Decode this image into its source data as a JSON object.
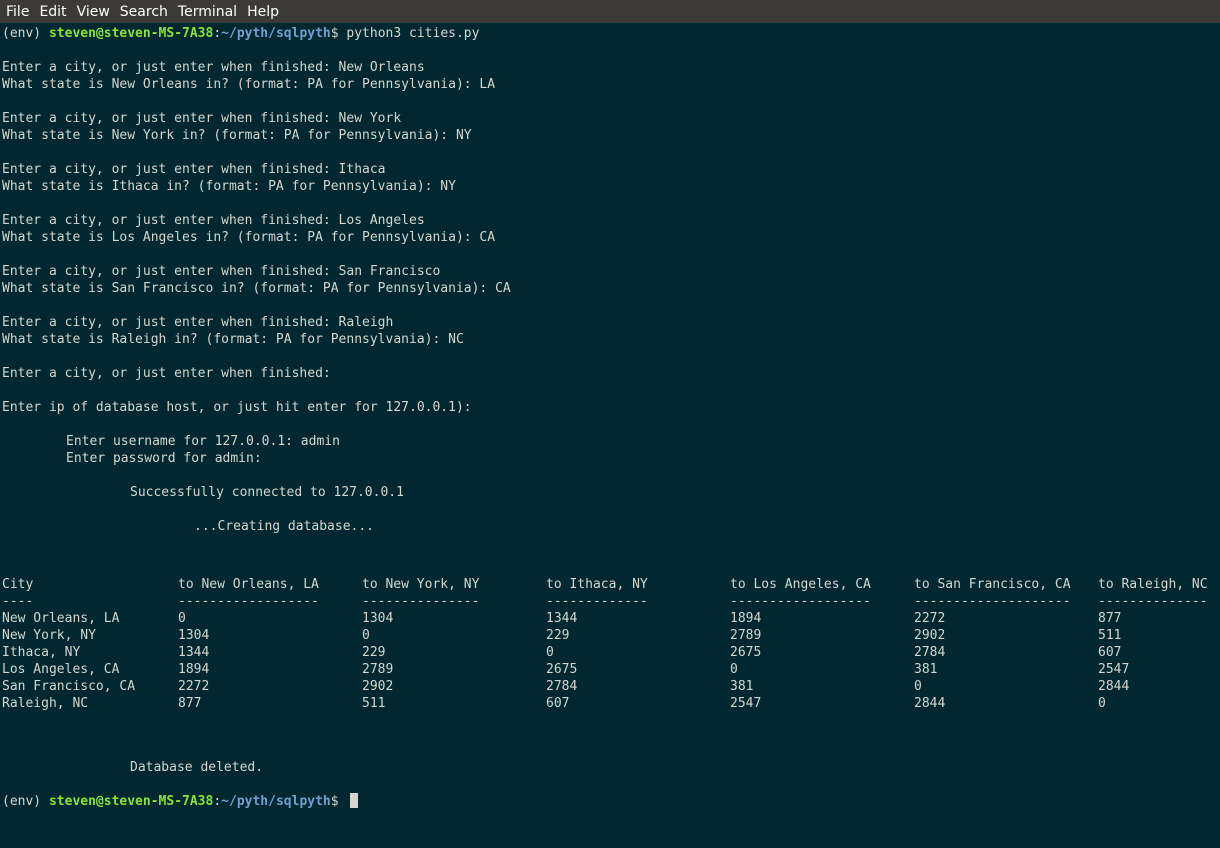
{
  "menu": [
    "File",
    "Edit",
    "View",
    "Search",
    "Terminal",
    "Help"
  ],
  "prompt": {
    "env": "(env) ",
    "user_host": "steven@steven-MS-7A38",
    "colon": ":",
    "path": "~/pyth/sqlpyth",
    "dollar": "$ ",
    "command": "python3 cities.py"
  },
  "session": [
    "",
    "Enter a city, or just enter when finished: New Orleans",
    "What state is New Orleans in? (format: PA for Pennsylvania): LA",
    "",
    "Enter a city, or just enter when finished: New York",
    "What state is New York in? (format: PA for Pennsylvania): NY",
    "",
    "Enter a city, or just enter when finished: Ithaca",
    "What state is Ithaca in? (format: PA for Pennsylvania): NY",
    "",
    "Enter a city, or just enter when finished: Los Angeles",
    "What state is Los Angeles in? (format: PA for Pennsylvania): CA",
    "",
    "Enter a city, or just enter when finished: San Francisco",
    "What state is San Francisco in? (format: PA for Pennsylvania): CA",
    "",
    "Enter a city, or just enter when finished: Raleigh",
    "What state is Raleigh in? (format: PA for Pennsylvania): NC",
    "",
    "Enter a city, or just enter when finished:",
    "",
    "Enter ip of database host, or just hit enter for 127.0.0.1):",
    ""
  ],
  "login": {
    "username_line": "Enter username for 127.0.0.1: admin",
    "password_line": "Enter password for admin:",
    "connected": "Successfully connected to 127.0.0.1",
    "creating": "...Creating database..."
  },
  "table": {
    "headers": [
      "City",
      "to New Orleans, LA",
      "to New York, NY",
      "to Ithaca, NY",
      "to Los Angeles, CA",
      "to San Francisco, CA",
      "to Raleigh, NC"
    ],
    "separators": [
      "----",
      "------------------",
      "---------------",
      "-------------",
      "------------------",
      "--------------------",
      "--------------"
    ],
    "rows": [
      [
        "New Orleans, LA",
        "0",
        "1304",
        "1344",
        "1894",
        "2272",
        "877"
      ],
      [
        "New York, NY",
        "1304",
        "0",
        "229",
        "2789",
        "2902",
        "511"
      ],
      [
        "Ithaca, NY",
        "1344",
        "229",
        "0",
        "2675",
        "2784",
        "607"
      ],
      [
        "Los Angeles, CA",
        "1894",
        "2789",
        "2675",
        "0",
        "381",
        "2547"
      ],
      [
        "San Francisco, CA",
        "2272",
        "2902",
        "2784",
        "381",
        "0",
        "2844"
      ],
      [
        "Raleigh, NC",
        "877",
        "511",
        "607",
        "2547",
        "2844",
        "0"
      ]
    ]
  },
  "deleted": "Database deleted."
}
